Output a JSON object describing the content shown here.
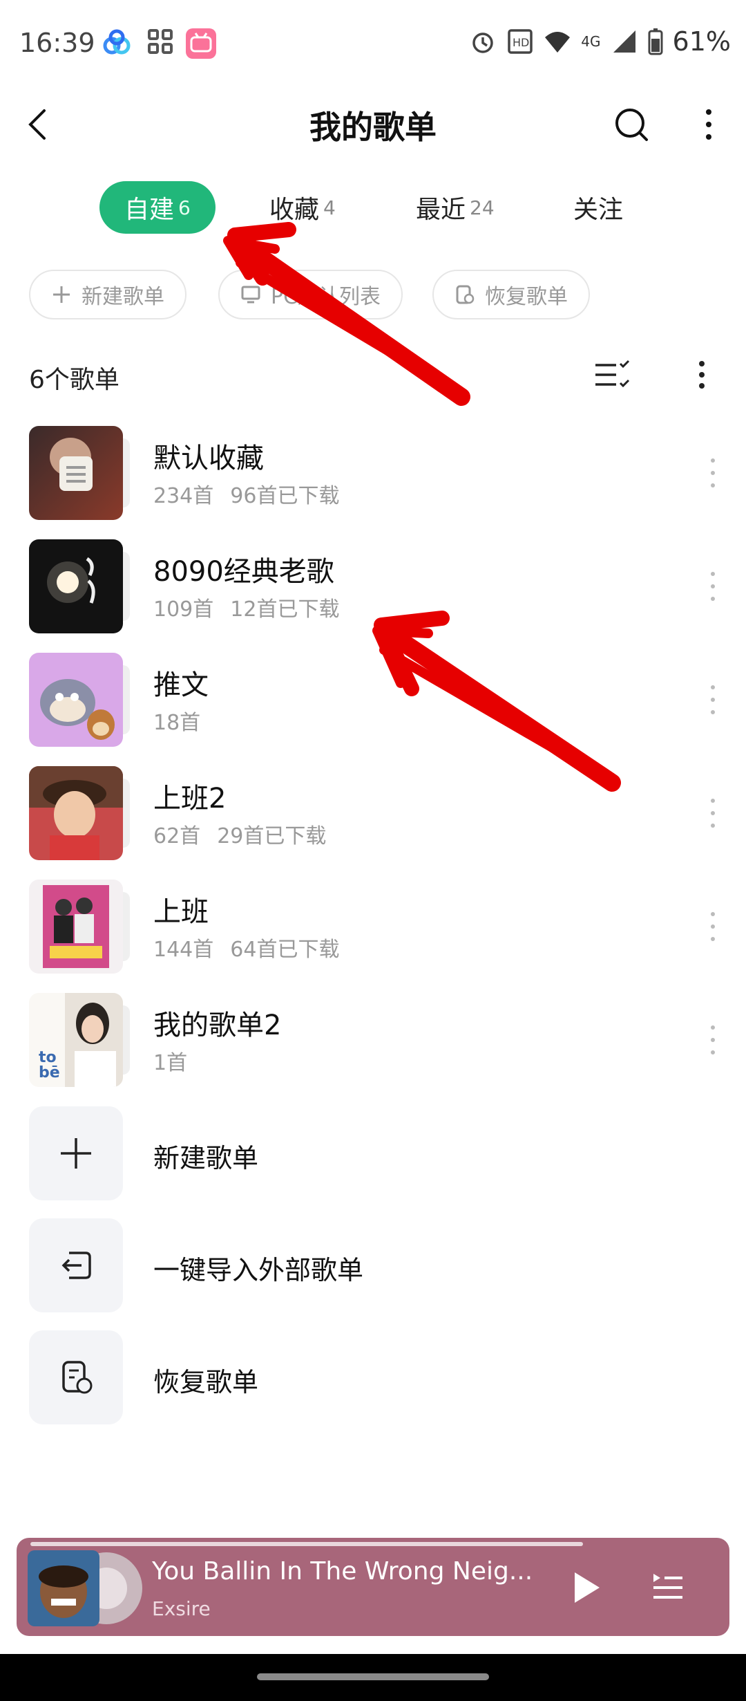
{
  "status_bar": {
    "time": "16:39",
    "battery": "61%",
    "network": "4G"
  },
  "header": {
    "title": "我的歌单"
  },
  "tabs": [
    {
      "label": "自建",
      "count": "6",
      "active": true
    },
    {
      "label": "收藏",
      "count": "4",
      "active": false
    },
    {
      "label": "最近",
      "count": "24",
      "active": false
    },
    {
      "label": "关注",
      "count": "",
      "active": false
    }
  ],
  "actions": {
    "new_playlist": "新建歌单",
    "pc_list": "PC默认列表",
    "restore": "恢复歌单"
  },
  "list": {
    "count_label": "6个歌单",
    "items": [
      {
        "name": "默认收藏",
        "songs": "234首",
        "downloaded": "96首已下载"
      },
      {
        "name": "8090经典老歌",
        "songs": "109首",
        "downloaded": "12首已下载"
      },
      {
        "name": "推文",
        "songs": "18首",
        "downloaded": ""
      },
      {
        "name": "上班2",
        "songs": "62首",
        "downloaded": "29首已下载"
      },
      {
        "name": "上班",
        "songs": "144首",
        "downloaded": "64首已下载"
      },
      {
        "name": "我的歌单2",
        "songs": "1首",
        "downloaded": ""
      }
    ]
  },
  "bottom_actions": {
    "new": "新建歌单",
    "import": "一键导入外部歌单",
    "restore": "恢复歌单"
  },
  "player": {
    "song": "You Ballin In The Wrong Neig...",
    "artist": "Exsire",
    "progress": 0.8
  },
  "colors": {
    "accent": "#21b77a",
    "player_bg": "#a8667a",
    "annotation": "#e60000"
  }
}
